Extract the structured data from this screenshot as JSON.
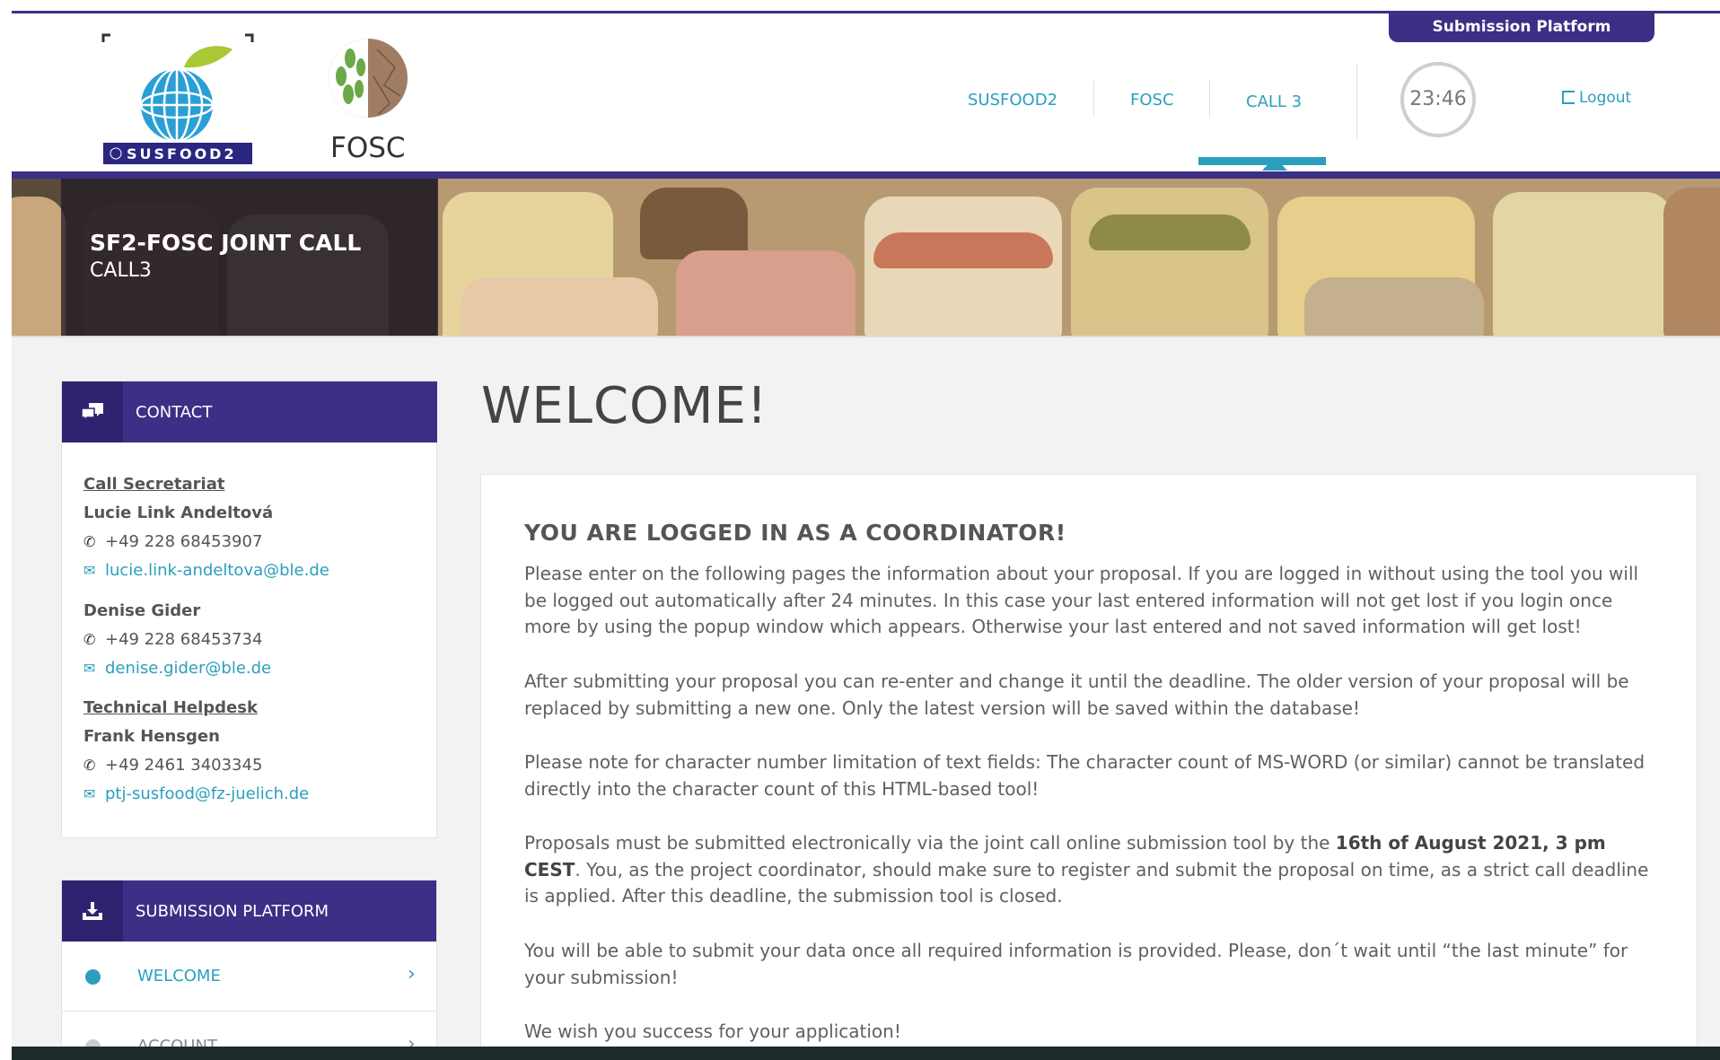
{
  "header": {
    "submission_tab": "Submission Platform",
    "logo_susfood": "SUSFOOD2",
    "logo_fosc": "FOSC",
    "nav": [
      "SUSFOOD2",
      "FOSC",
      "CALL 3"
    ],
    "timer": "23:46",
    "logout": "Logout"
  },
  "banner": {
    "title": "SF2-FOSC JOINT CALL",
    "subtitle": "CALL3"
  },
  "contact": {
    "heading": "CONTACT",
    "secretariat_label": "Call Secretariat",
    "people": [
      {
        "name": "Lucie Link Andeltová",
        "phone": "+49 228 68453907",
        "email": "lucie.link-andeltova@ble.de"
      },
      {
        "name": "Denise Gider",
        "phone": "+49 228 68453734",
        "email": "denise.gider@ble.de"
      }
    ],
    "helpdesk_label": "Technical Helpdesk",
    "helpdesk": {
      "name": "Frank Hensgen",
      "phone": "+49 2461 3403345",
      "email": "ptj-susfood@fz-juelich.de"
    }
  },
  "submission": {
    "heading": "SUBMISSION PLATFORM",
    "items": [
      "WELCOME",
      "ACCOUNT"
    ]
  },
  "main": {
    "title": "WELCOME!",
    "subtitle": "YOU ARE LOGGED IN AS A COORDINATOR!",
    "p1": "Please enter on the following pages the information about your proposal. If you are logged in without using the tool you will be logged out automatically after 24 minutes. In this case your last entered information will not get lost if you login once more by using the popup window which appears. Otherwise your last entered and not saved information will get lost!",
    "p2": "After submitting your proposal you can re-enter and change it until the deadline. The older version of your proposal will be replaced by submitting a new one. Only the latest version will be saved within the database!",
    "p3": "Please note for character number limitation of text fields: The character count of MS-WORD (or similar) cannot be translated directly into the character count of this HTML-based tool!",
    "p4_pre": "Proposals must be submitted electronically via the joint call online submission tool by the ",
    "p4_bold": "16th of August 2021, 3 pm CEST",
    "p4_post": ". You, as the project coordinator, should make sure to register and submit the proposal on time, as a strict call deadline is applied. After this deadline, the submission tool is closed.",
    "p5": "You will be able to submit your data once all required information is provided. Please, don´t wait until “the last minute” for your submission!",
    "p6": "We wish you success for your application!"
  },
  "colors": {
    "brand": "#3c2f86",
    "accent": "#2a9fbd"
  }
}
